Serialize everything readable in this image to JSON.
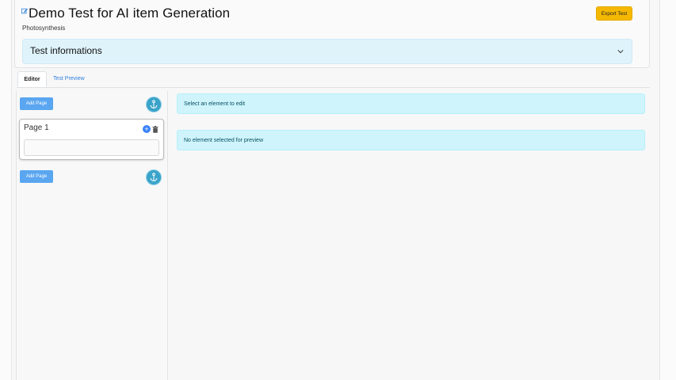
{
  "header": {
    "title": "Demo Test for AI item Generation",
    "subtitle": "Photosynthesis",
    "export_label": "Export Test"
  },
  "accordion": {
    "label": "Test informations"
  },
  "tabs": [
    {
      "label": "Editor",
      "active": true
    },
    {
      "label": "Test Preview",
      "active": false
    }
  ],
  "sidebar": {
    "add_page_top": "Add Page",
    "add_page_bottom": "Add Page",
    "pages": [
      {
        "label": "Page 1"
      }
    ]
  },
  "main": {
    "edit_message": "Select an element to edit",
    "preview_message": "No element selected for preview"
  },
  "colors": {
    "accent": "#5aa6f0",
    "warning": "#f5b800",
    "info_bg": "#cff4fc",
    "info_text": "#055160"
  }
}
